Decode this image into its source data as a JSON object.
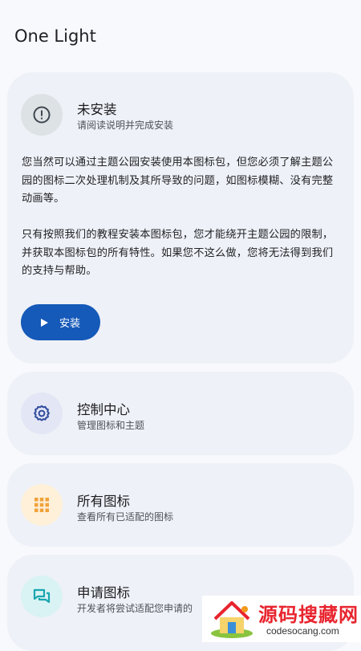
{
  "app": {
    "title": "One Light"
  },
  "install_card": {
    "title": "未安装",
    "subtitle": "请阅读说明并完成安装",
    "paragraph_1": "您当然可以通过主题公园安装使用本图标包，但您必须了解主题公园的图标二次处理机制及其所导致的问题，如图标模糊、没有完整动画等。",
    "paragraph_2": "只有按照我们的教程安装本图标包，您才能绕开主题公园的限制，并获取本图标包的所有特性。如果您不这么做，您将无法得到我们的支持与帮助。",
    "button_label": "安装",
    "icon": "alert-circle-icon"
  },
  "cards": [
    {
      "title": "控制中心",
      "subtitle": "管理图标和主题",
      "icon": "gear-icon",
      "icon_bg": "#e2e6f5",
      "icon_color": "#2f4b9c"
    },
    {
      "title": "所有图标",
      "subtitle": "查看所有已适配的图标",
      "icon": "grid-icon",
      "icon_bg": "#fff0d9",
      "icon_color": "#f0a23a"
    },
    {
      "title": "申请图标",
      "subtitle": "开发者将尝试适配您申请的",
      "icon": "chat-icon",
      "icon_bg": "#d9f3f4",
      "icon_color": "#19a6ae"
    }
  ],
  "watermark": {
    "brand": "源码搜藏网",
    "url": "codesocang.com"
  }
}
